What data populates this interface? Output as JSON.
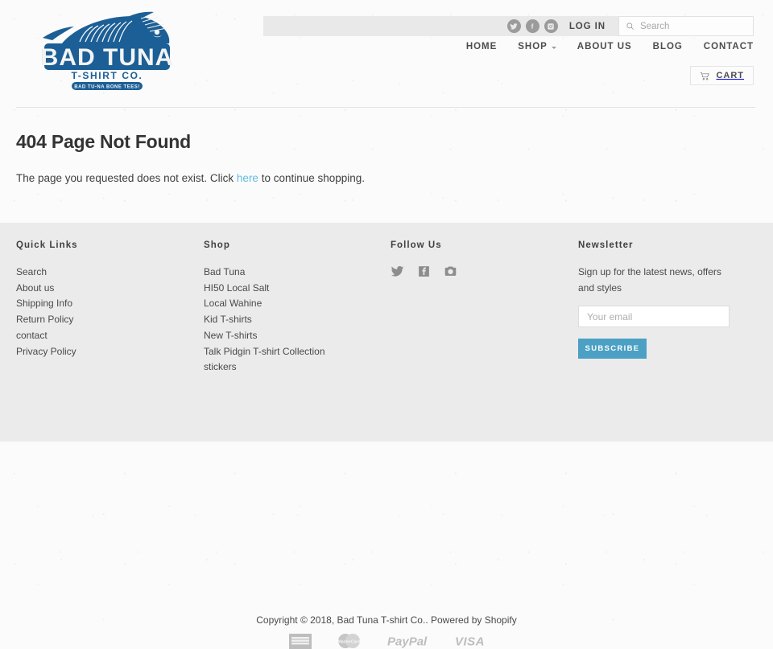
{
  "brand": {
    "logo_name_top": "BAD TUNA",
    "logo_sub": "T-SHIRT CO.",
    "logo_tagline": "BAD TU-NA BONE TEES!",
    "logo_color": "#1b5f96"
  },
  "topbar": {
    "social": [
      {
        "name": "twitter-icon",
        "label": "Twitter"
      },
      {
        "name": "facebook-icon",
        "label": "Facebook"
      },
      {
        "name": "instagram-icon",
        "label": "Instagram"
      }
    ],
    "login_label": "LOG IN",
    "search": {
      "placeholder": "Search",
      "value": "",
      "icon": "search-icon"
    }
  },
  "nav": {
    "items": [
      {
        "label": "HOME",
        "has_dropdown": false
      },
      {
        "label": "SHOP",
        "has_dropdown": true
      },
      {
        "label": "ABOUT US",
        "has_dropdown": false
      },
      {
        "label": "BLOG",
        "has_dropdown": false
      },
      {
        "label": "CONTACT",
        "has_dropdown": false
      }
    ],
    "cart_label": "CART",
    "cart_icon": "shopping-cart-icon"
  },
  "main": {
    "title": "404 Page Not Found",
    "text_before": "The page you requested does not exist. Click ",
    "link_text": "here",
    "text_after": " to continue shopping.",
    "link_color": "#63bcdd"
  },
  "footer": {
    "quick_links": {
      "title": "Quick Links",
      "items": [
        "Search",
        "About us",
        "Shipping Info",
        "Return Policy",
        "contact",
        "Privacy Policy"
      ]
    },
    "shop": {
      "title": "Shop",
      "items": [
        "Bad Tuna",
        "HI50 Local Salt",
        "Local Wahine",
        "Kid T-shirts",
        "New T-shirts",
        "Talk Pidgin T-shirt Collection",
        "stickers"
      ]
    },
    "follow": {
      "title": "Follow Us",
      "items": [
        {
          "name": "twitter-icon",
          "label": "Twitter"
        },
        {
          "name": "facebook-icon",
          "label": "Facebook"
        },
        {
          "name": "instagram-icon",
          "label": "Instagram"
        }
      ]
    },
    "newsletter": {
      "title": "Newsletter",
      "description": "Sign up for the latest news, offers and styles",
      "email_placeholder": "Your email",
      "email_value": "",
      "subscribe_label": "SUBSCRIBE",
      "subscribe_color": "#4ba0c4"
    },
    "copyright_prefix": "Copyright © 2018, ",
    "copyright_store": "Bad Tuna T-shirt Co.",
    "copyright_mid": ". Powered by ",
    "copyright_platform": "Shopify",
    "payments": [
      {
        "name": "american-express-icon",
        "label": "American Express"
      },
      {
        "name": "mastercard-icon",
        "label": "MasterCard"
      },
      {
        "name": "paypal-icon",
        "label": "PayPal"
      },
      {
        "name": "visa-icon",
        "label": "VISA"
      }
    ]
  }
}
